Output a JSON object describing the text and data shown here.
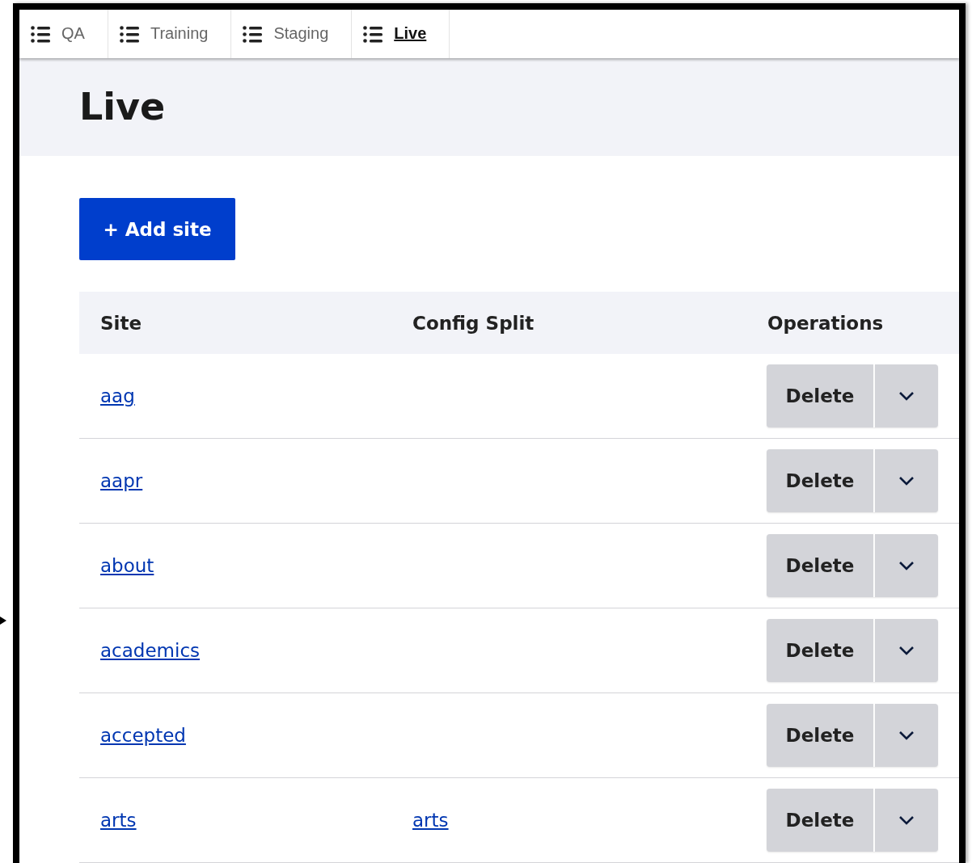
{
  "tabs": [
    {
      "label": "QA",
      "selected": false
    },
    {
      "label": "Training",
      "selected": false
    },
    {
      "label": "Staging",
      "selected": false
    },
    {
      "label": "Live",
      "selected": true
    }
  ],
  "page_title": "Live",
  "add_button": "+ Add site",
  "table": {
    "columns": [
      "Site",
      "Config Split",
      "Operations"
    ],
    "rows": [
      {
        "site": "aag",
        "operation": "Delete"
      },
      {
        "site": "aapr",
        "operation": "Delete"
      },
      {
        "site": "about",
        "operation": "Delete"
      },
      {
        "site": "academics",
        "operation": "Delete"
      },
      {
        "site": "accepted",
        "operation": "Delete"
      },
      {
        "site": "arts",
        "config_split": "arts",
        "operation": "Delete"
      }
    ]
  }
}
